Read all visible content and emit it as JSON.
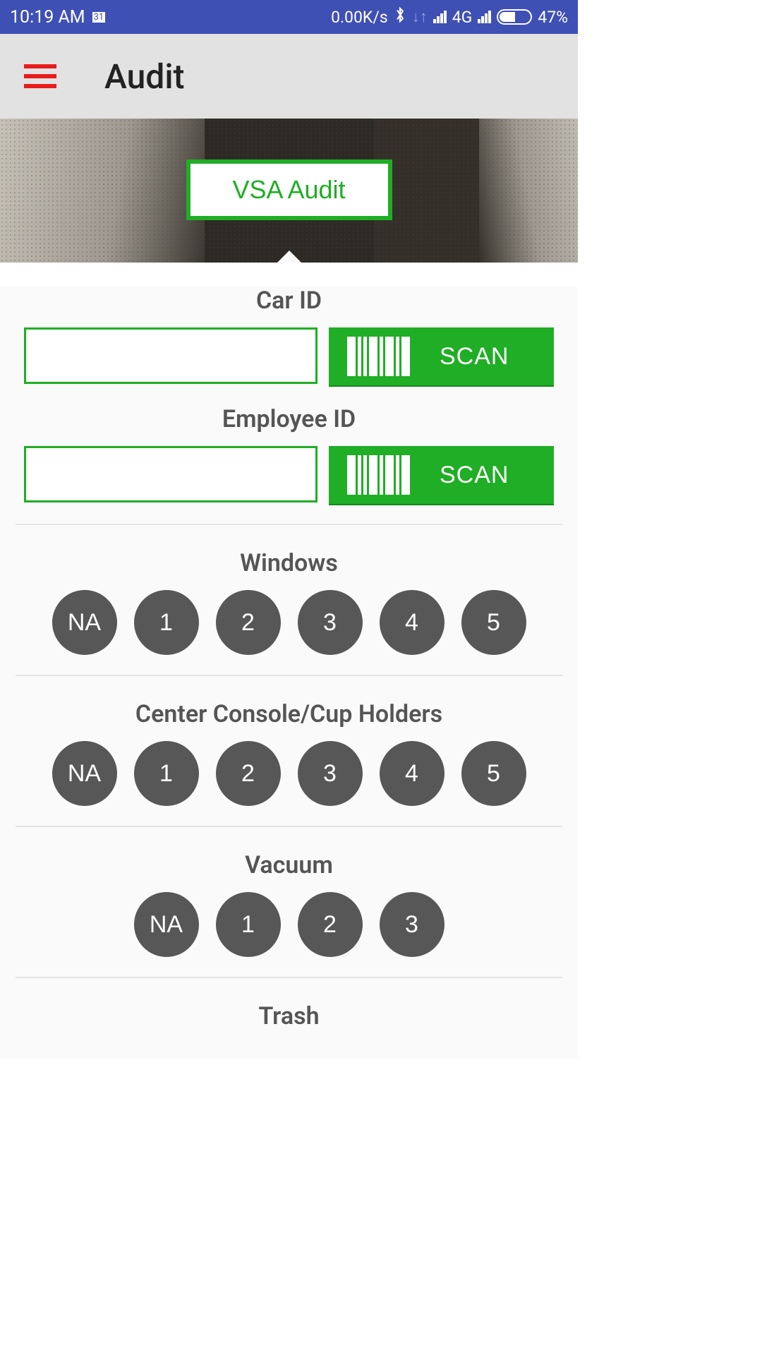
{
  "status": {
    "time": "10:19 AM",
    "rate": "0.00K/s",
    "net": "4G",
    "battery": "47%"
  },
  "appbar": {
    "title": "Audit"
  },
  "hero": {
    "button_label": "VSA Audit"
  },
  "scan": {
    "car_label": "Car ID",
    "car_value": "",
    "emp_label": "Employee ID",
    "emp_value": "",
    "btn": "SCAN"
  },
  "ratings": {
    "windows": {
      "label": "Windows",
      "opts": [
        "NA",
        "1",
        "2",
        "3",
        "4",
        "5"
      ]
    },
    "console": {
      "label": "Center Console/Cup Holders",
      "opts": [
        "NA",
        "1",
        "2",
        "3",
        "4",
        "5"
      ]
    },
    "vacuum": {
      "label": "Vacuum",
      "opts": [
        "NA",
        "1",
        "2",
        "3"
      ]
    },
    "trash": {
      "label": "Trash"
    }
  }
}
